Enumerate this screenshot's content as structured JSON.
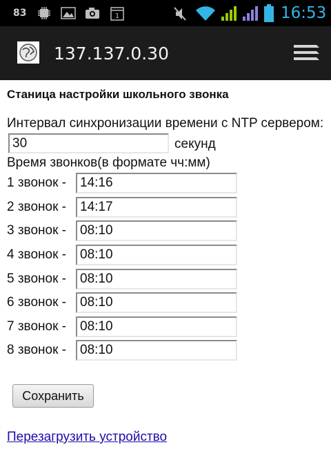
{
  "status_bar": {
    "notification_count": "83",
    "time": "16:53",
    "icons": [
      "chip-icon",
      "image-icon",
      "camera-icon",
      "calendar-icon",
      "mute-icon",
      "wifi-icon",
      "signal-icon",
      "signal-icon",
      "battery-icon"
    ]
  },
  "browser": {
    "url": "137.137.0.30",
    "favicon": "globe-icon",
    "menu_icon": "menu-icon"
  },
  "page": {
    "heading": "Станица настройки школьного звонка",
    "sync": {
      "label": "Интервал синхронизации времени с NTP сервером:",
      "value": "30",
      "unit": "секунд"
    },
    "bells_label": "Время звонков(в формате чч:мм)",
    "bells": [
      {
        "label": "1 звонок -",
        "value": "14:16"
      },
      {
        "label": "2 звонок -",
        "value": "14:17"
      },
      {
        "label": "3 звонок -",
        "value": "08:10"
      },
      {
        "label": "4 звонок -",
        "value": "08:10"
      },
      {
        "label": "5 звонок -",
        "value": "08:10"
      },
      {
        "label": "6 звонок -",
        "value": "08:10"
      },
      {
        "label": "7 звонок -",
        "value": "08:10"
      },
      {
        "label": "8 звонок -",
        "value": "08:10"
      }
    ],
    "save_label": "Сохранить",
    "reboot_link": "Перезагрузить устройство"
  },
  "colors": {
    "status_bar_bg": "#000000",
    "title_bar_bg": "#1c1c1c",
    "time_color": "#33b5e5",
    "link_color": "#1a0dab",
    "signal_color": "#99cc00",
    "signal_secondary": "#8f7fe0"
  }
}
